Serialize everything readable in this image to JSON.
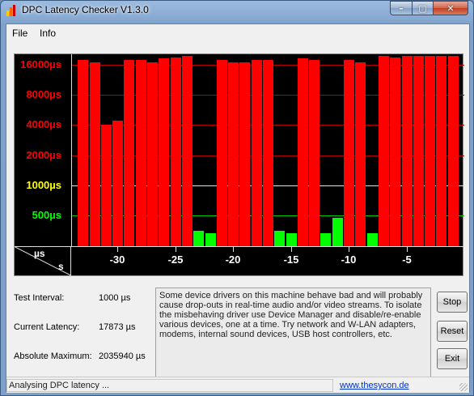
{
  "window": {
    "title": "DPC Latency Checker V1.3.0",
    "controls": {
      "minimize": "–",
      "maximize": "▢",
      "close": "✕"
    }
  },
  "menu": [
    "File",
    "Info"
  ],
  "colors": {
    "graph_bg": "#000000",
    "bar_high": "#ff0000",
    "bar_ok": "#00ff00",
    "label_red": "#ff0000",
    "label_yellow": "#ffff00",
    "label_green": "#00ff00",
    "grid_red": "#b40000",
    "grid_yellow": "#ffff00",
    "grid_green": "#00c800"
  },
  "chart_data": {
    "type": "bar",
    "y_scale": "log2",
    "y_unit": "µs",
    "y_labels": [
      {
        "text": "16000µs",
        "value": 16000,
        "color": "red"
      },
      {
        "text": "8000µs",
        "value": 8000,
        "color": "red"
      },
      {
        "text": "4000µs",
        "value": 4000,
        "color": "red"
      },
      {
        "text": "2000µs",
        "value": 2000,
        "color": "red"
      },
      {
        "text": "1000µs",
        "value": 1000,
        "color": "yellow"
      },
      {
        "text": "500µs",
        "value": 500,
        "color": "green"
      }
    ],
    "corner_y_unit": "µs",
    "corner_x_unit": "s",
    "x_ticks": [
      "-30",
      "-25",
      "-20",
      "-15",
      "-10",
      "-5"
    ],
    "x_range": [
      -34,
      0
    ],
    "bars": [
      {
        "t": -33,
        "value": 17800
      },
      {
        "t": -32,
        "value": 17000
      },
      {
        "t": -31,
        "value": 4000
      },
      {
        "t": -30,
        "value": 4400
      },
      {
        "t": -29,
        "value": 17800
      },
      {
        "t": -28,
        "value": 17800
      },
      {
        "t": -27,
        "value": 17000
      },
      {
        "t": -26,
        "value": 18500
      },
      {
        "t": -25,
        "value": 18800
      },
      {
        "t": -24,
        "value": 19500
      },
      {
        "t": -23,
        "value": 350
      },
      {
        "t": -22,
        "value": 330
      },
      {
        "t": -21,
        "value": 17800
      },
      {
        "t": -20,
        "value": 17000
      },
      {
        "t": -19,
        "value": 17000
      },
      {
        "t": -18,
        "value": 17800
      },
      {
        "t": -17,
        "value": 17800
      },
      {
        "t": -16,
        "value": 350
      },
      {
        "t": -15,
        "value": 330
      },
      {
        "t": -14,
        "value": 18500
      },
      {
        "t": -13,
        "value": 17800
      },
      {
        "t": -12,
        "value": 330
      },
      {
        "t": -11,
        "value": 470
      },
      {
        "t": -10,
        "value": 17800
      },
      {
        "t": -9,
        "value": 17000
      },
      {
        "t": -8,
        "value": 330
      },
      {
        "t": -7,
        "value": 19500
      },
      {
        "t": -6,
        "value": 18800
      },
      {
        "t": -5,
        "value": 19500
      },
      {
        "t": -4,
        "value": 19500
      },
      {
        "t": -3,
        "value": 19500
      },
      {
        "t": -2,
        "value": 19500
      },
      {
        "t": -1,
        "value": 19500
      }
    ]
  },
  "info": {
    "test_interval_label": "Test Interval:",
    "test_interval_value": "1000 µs",
    "current_latency_label": "Current Latency:",
    "current_latency_value": "17873 µs",
    "absolute_max_label": "Absolute Maximum:",
    "absolute_max_value": "2035940 µs"
  },
  "message": "Some device drivers on this machine behave bad and will probably cause drop-outs in real-time audio and/or video streams. To isolate the misbehaving driver use Device Manager and disable/re-enable various devices, one at a time. Try network and W-LAN adapters, modems, internal sound devices, USB host controllers, etc.",
  "buttons": {
    "stop": "Stop",
    "reset": "Reset",
    "exit": "Exit"
  },
  "status": {
    "text": "Analysing DPC latency ...",
    "link": "www.thesycon.de"
  }
}
